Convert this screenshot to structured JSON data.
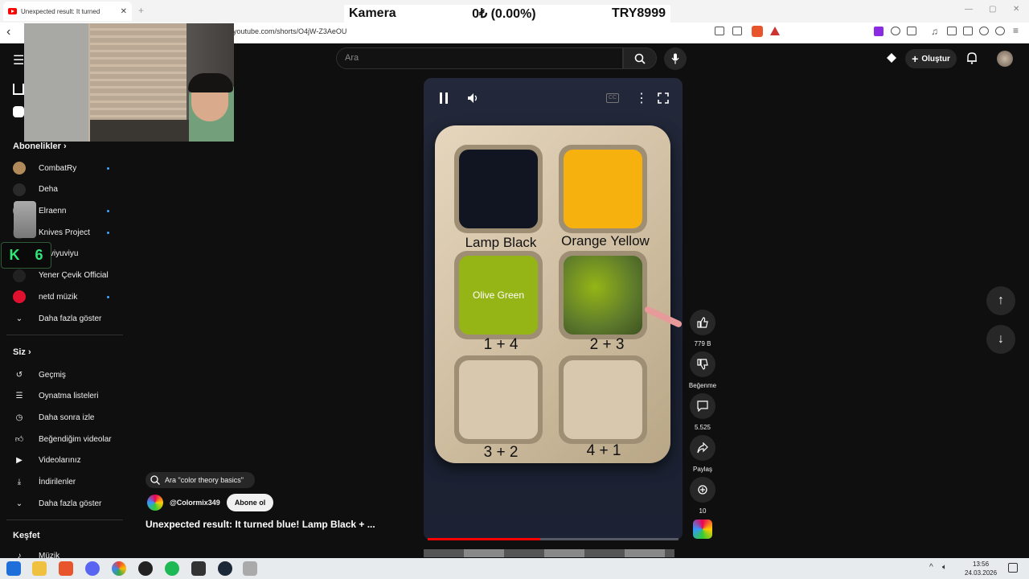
{
  "browser": {
    "tab_title": "Unexpected result: It turned",
    "url": "youtube.com/shorts/O4jW-Z3AeOU"
  },
  "ticker": {
    "label": "Kamera",
    "change": "0₺ (0.00%)",
    "price": "TRY8999"
  },
  "header": {
    "search_placeholder": "Ara",
    "create_label": "Oluştur"
  },
  "sidebar": {
    "subs_heading": "Abonelikler",
    "subscriptions": [
      {
        "name": "CombatRy",
        "avatar_color": "#b08a5a",
        "new": true
      },
      {
        "name": "Deha",
        "avatar_color": "#2a2a2a",
        "new": false
      },
      {
        "name": "Elraenn",
        "avatar_color": "#8a8a8a",
        "new": true
      },
      {
        "name": "Knives Project",
        "avatar_color": "#333333",
        "new": true
      },
      {
        "name": "amviyuviyu",
        "avatar_color": "#444444",
        "new": false
      },
      {
        "name": "Yener Çevik Official",
        "avatar_color": "#222222",
        "new": false
      },
      {
        "name": "netd müzik",
        "avatar_color": "#e0102f",
        "new": true
      }
    ],
    "show_more": "Daha fazla göster",
    "you_heading": "Siz",
    "you_items": [
      "Geçmiş",
      "Oynatma listeleri",
      "Daha sonra izle",
      "Beğendiğim videolar",
      "Videolarınız",
      "İndirilenler",
      "Daha fazla göster"
    ],
    "explore_heading": "Keşfet",
    "explore_items": [
      "Müzik"
    ]
  },
  "overlay_badge": {
    "letter": "K",
    "number": "6"
  },
  "video": {
    "labels": {
      "lamp_black": "Lamp Black",
      "orange_yellow": "Orange Yellow",
      "olive_green": "Olive Green",
      "mix_1_4": "1 + 4",
      "mix_2_3": "2 + 3",
      "mix_3_2": "3 + 2",
      "mix_4_1": "4 + 1"
    },
    "progress": 0.45,
    "colors": {
      "lamp_black": "#111421",
      "orange_yellow": "#f6b10f",
      "olive_green": "#95b516",
      "mix_green": "#5d7a2c",
      "empty": "#d8c8ad"
    }
  },
  "actions": {
    "likes": "779 B",
    "dislike_label": "Beğenme",
    "comments": "5.525",
    "share_label": "Paylaş",
    "remix": "10"
  },
  "below": {
    "suggestion": "Ara \"color theory basics\"",
    "channel": "@Colormix349",
    "subscribe": "Abone ol",
    "title": "Unexpected result: It turned blue! Lamp Black + ..."
  },
  "taskbar": {
    "time": "13:56",
    "date": "24.03.2026"
  }
}
